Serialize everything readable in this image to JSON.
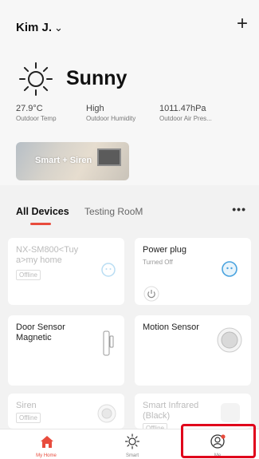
{
  "header": {
    "home_name": "Kim J.",
    "chevron": "⌄",
    "add": "+"
  },
  "weather": {
    "icon": "sun-icon",
    "condition": "Sunny",
    "stats": [
      {
        "value": "27.9°C",
        "label": "Outdoor Temp"
      },
      {
        "value": "High",
        "label": "Outdoor Humidity"
      },
      {
        "value": "1011.47hPa",
        "label": "Outdoor Air Pres..."
      }
    ]
  },
  "scene": {
    "label": "Smart + Siren"
  },
  "tabs": {
    "items": [
      "All Devices",
      "Testing RooM"
    ],
    "active": 0,
    "more": "•••"
  },
  "devices": [
    {
      "name": "NX-SM800<Tuy a>my home",
      "status": "Offline",
      "icon": "outlet-icon"
    },
    {
      "name": "Power plug",
      "status": "Turned Off",
      "icon": "outlet-icon"
    },
    {
      "name": "Door Sensor Magnetic",
      "status": "",
      "icon": "door-sensor-icon"
    },
    {
      "name": "Motion Sensor",
      "status": "",
      "icon": "motion-sensor-icon"
    },
    {
      "name": "Siren",
      "status": "Offline",
      "icon": "siren-icon"
    },
    {
      "name": "Smart Infrared (Black)",
      "status": "Offline",
      "icon": "infrared-icon"
    }
  ],
  "nav": {
    "items": [
      {
        "label": "My Home",
        "icon": "home-icon"
      },
      {
        "label": "Smart",
        "icon": "sun-outline-icon"
      },
      {
        "label": "Me",
        "icon": "profile-icon"
      }
    ],
    "active": 0
  },
  "colors": {
    "accent": "#e84c3d",
    "highlight": "#e0001b",
    "device_blue": "#4aa3df"
  }
}
